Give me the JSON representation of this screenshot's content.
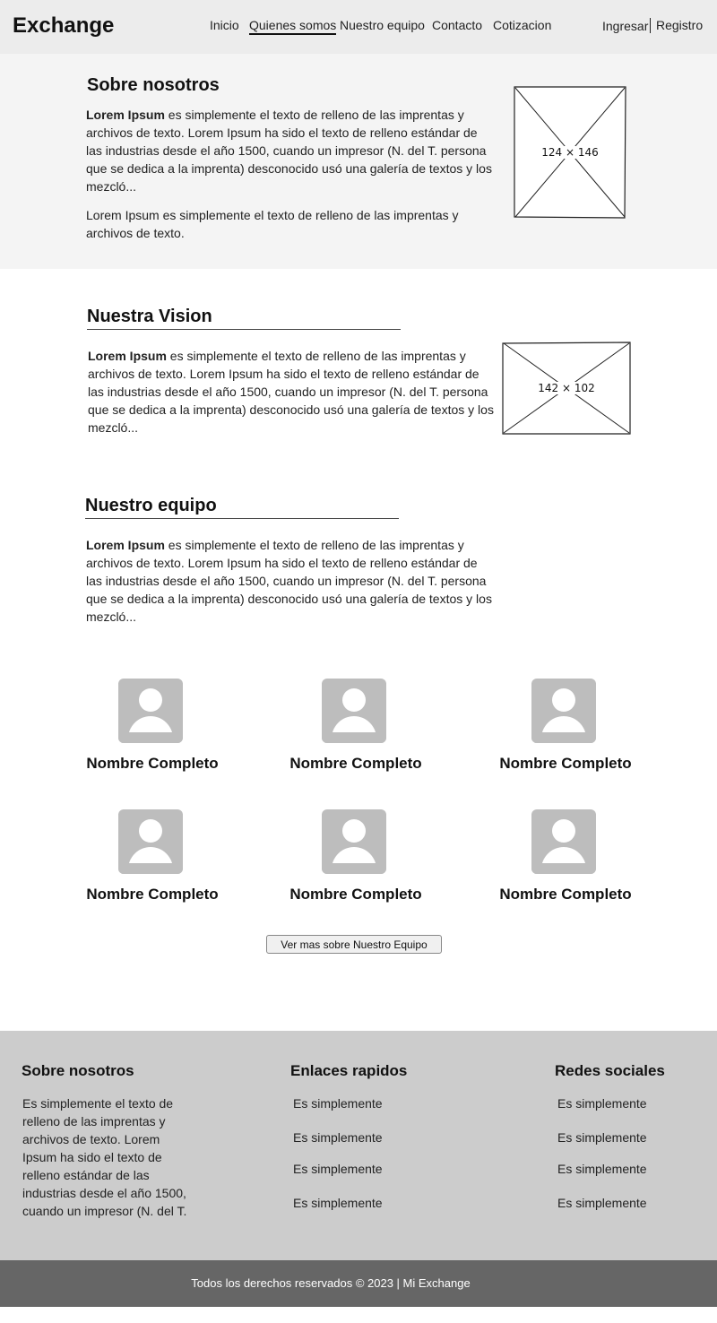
{
  "header": {
    "brand": "Exchange",
    "nav": [
      "Inicio",
      "Quienes somos",
      "Nuestro equipo",
      "Contacto",
      "Cotizacion"
    ],
    "active_nav": "Quienes somos",
    "login": "Ingresar",
    "register": "Registro"
  },
  "about": {
    "title": "Sobre nosotros",
    "para1_bold": "Lorem Ipsum",
    "para1_rest": " es simplemente el texto de relleno de las imprentas y archivos de texto. Lorem Ipsum ha sido el texto de relleno estándar de las industrias desde el año 1500, cuando un impresor (N. del T. persona que se dedica a la imprenta) desconocido usó una galería de textos y los mezcló...",
    "para2": "Lorem Ipsum es simplemente el texto de relleno de las imprentas y archivos de texto.",
    "image_label": "124 × 146"
  },
  "vision": {
    "title": "Nuestra Vision",
    "para_bold": "Lorem Ipsum",
    "para_rest": " es simplemente el texto de relleno de las imprentas y archivos de texto. Lorem Ipsum ha sido el texto de relleno estándar de las industrias desde el año 1500, cuando un impresor (N. del T. persona que se dedica a la imprenta) desconocido usó una galería de textos y los mezcló...",
    "image_label": "142 × 102"
  },
  "team": {
    "title": "Nuestro equipo",
    "para_bold": "Lorem Ipsum",
    "para_rest": " es simplemente el texto de relleno de las imprentas y archivos de texto. Lorem Ipsum ha sido el texto de relleno estándar de las industrias desde el año 1500, cuando un impresor (N. del T. persona que se dedica a la imprenta) desconocido usó una galería de textos y los mezcló...",
    "members": [
      {
        "name": "Nombre Completo",
        "icon": "user-avatar-icon"
      },
      {
        "name": "Nombre Completo",
        "icon": "user-avatar-icon"
      },
      {
        "name": "Nombre Completo",
        "icon": "user-avatar-icon"
      },
      {
        "name": "Nombre Completo",
        "icon": "user-avatar-icon"
      },
      {
        "name": "Nombre Completo",
        "icon": "user-avatar-icon"
      },
      {
        "name": "Nombre Completo",
        "icon": "user-avatar-icon"
      }
    ],
    "more_button": "Ver mas sobre Nuestro Equipo"
  },
  "footer": {
    "about_title": "Sobre nosotros",
    "about_text": "Es simplemente el texto de relleno de las imprentas y archivos de texto. Lorem Ipsum ha sido el texto de relleno estándar de las industrias desde el año 1500, cuando un impresor (N. del T.",
    "links_title": "Enlaces rapidos",
    "links": [
      "Es simplemente",
      "Es simplemente",
      "Es simplemente",
      "Es simplemente"
    ],
    "social_title": "Redes sociales",
    "social": [
      "Es simplemente",
      "Es simplemente",
      "Es simplemente",
      "Es simplemente"
    ],
    "copyright": "Todos los derechos reservados © 2023 | Mi Exchange"
  },
  "colors": {
    "header_bg": "#ececec",
    "about_bg": "#f4f4f4",
    "avatar_bg": "#bdbdbd",
    "footer_bg": "#cccccc",
    "copyright_bg": "#666666"
  }
}
